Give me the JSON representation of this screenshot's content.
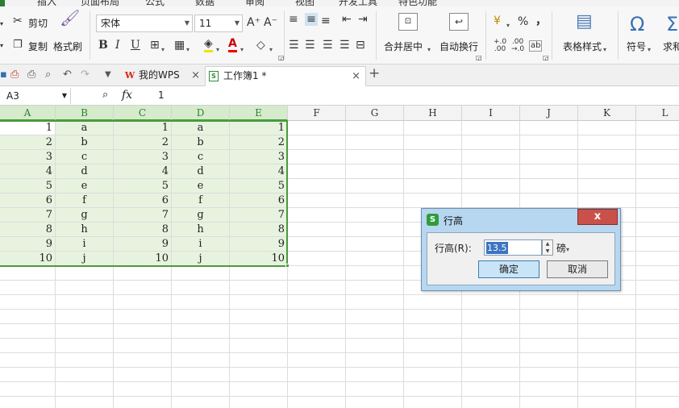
{
  "menu": [
    "插入",
    "页面布局",
    "公式",
    "数据",
    "审阅",
    "视图",
    "开发工具",
    "特色功能"
  ],
  "ribbon": {
    "cut": "剪切",
    "copy": "复制",
    "format_painter": "格式刷",
    "font_name": "宋体",
    "font_size": "11",
    "grow_font": "A⁺",
    "shrink_font": "A⁻",
    "bold": "B",
    "italic": "I",
    "underline": "U",
    "merge_center": "合并居中",
    "wrap_text": "自动换行",
    "percent": "%",
    "comma": "，",
    "table_style": "表格样式",
    "symbol": "符号",
    "sum": "求和",
    "omega": "Ω",
    "sigma": "Σ"
  },
  "tabs": [
    {
      "label": "我的WPS"
    },
    {
      "label": "工作簿1 *"
    }
  ],
  "formula_bar": {
    "name_box": "A3",
    "fx": "fx",
    "value": "1"
  },
  "columns": [
    "A",
    "B",
    "C",
    "D",
    "E",
    "F",
    "G",
    "H",
    "I",
    "J",
    "K",
    "L"
  ],
  "rows": [
    [
      "1",
      "a",
      "1",
      "a",
      "1"
    ],
    [
      "2",
      "b",
      "2",
      "b",
      "2"
    ],
    [
      "3",
      "c",
      "3",
      "c",
      "3"
    ],
    [
      "4",
      "d",
      "4",
      "d",
      "4"
    ],
    [
      "5",
      "e",
      "5",
      "e",
      "5"
    ],
    [
      "6",
      "f",
      "6",
      "f",
      "6"
    ],
    [
      "7",
      "g",
      "7",
      "g",
      "7"
    ],
    [
      "8",
      "h",
      "8",
      "h",
      "8"
    ],
    [
      "9",
      "i",
      "9",
      "i",
      "9"
    ],
    [
      "10",
      "j",
      "10",
      "j",
      "10"
    ]
  ],
  "dialog": {
    "title": "行高",
    "close": "x",
    "label": "行高(R):",
    "value": "13.5",
    "unit": "磅",
    "ok": "确定",
    "cancel": "取消"
  },
  "colors": {
    "accent": "#4a9b3a",
    "selection_fill": "#e7f3df",
    "dialog_frame": "#b7d7f0",
    "close_button": "#c9514a"
  }
}
